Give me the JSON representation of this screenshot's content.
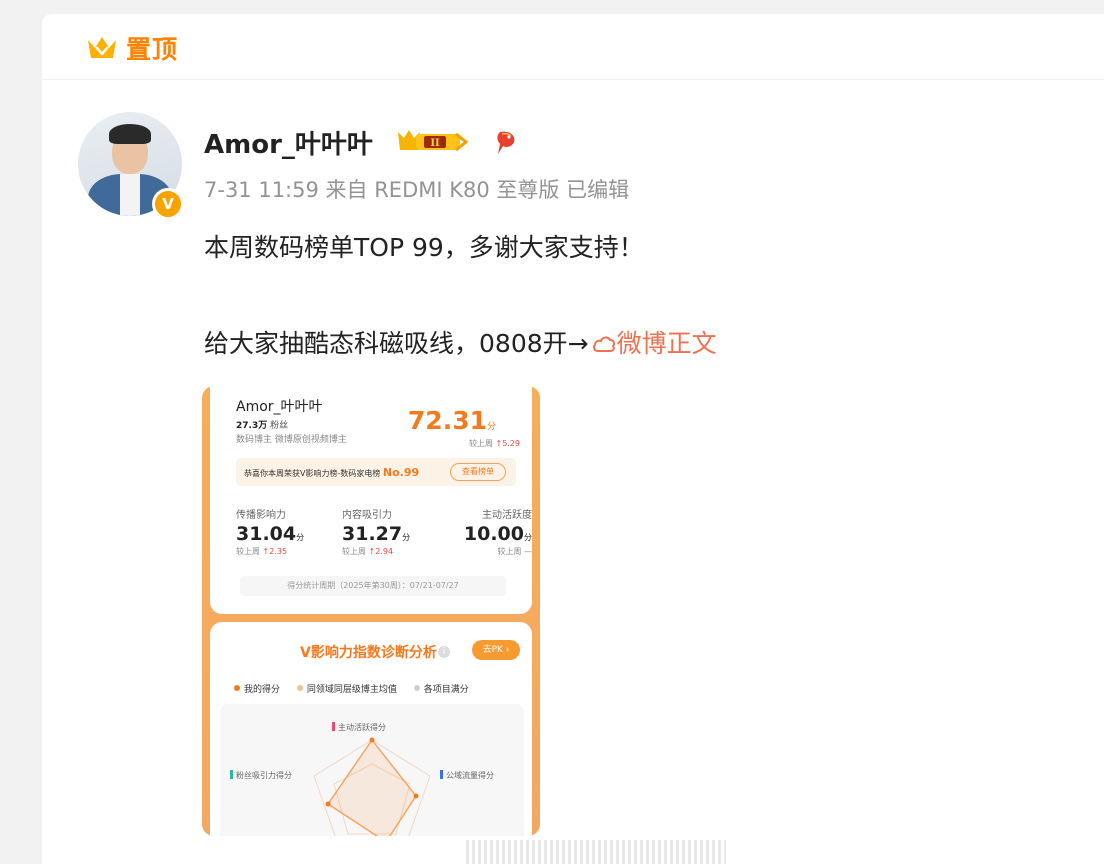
{
  "pinned": {
    "label": "置顶"
  },
  "author": {
    "name": "Amor_叶叶叶",
    "verified_badge": "V"
  },
  "meta": {
    "text": "7-31 11:59  来自 REDMI K80 至尊版 已编辑"
  },
  "post": {
    "line1": "本周数码榜单TOP 99，多谢大家支持！",
    "line2": "给大家抽酷态科磁吸线，0808开→",
    "link_text": "微博正文"
  },
  "screenshot": {
    "name": "Amor_叶叶叶",
    "fans_count": "27.3万",
    "fans_label": "粉丝",
    "role": "数码博主 微博原创视频博主",
    "score": "72.31",
    "score_unit": "分",
    "score_cmp_label": "较上周",
    "score_cmp_value": "5.29",
    "notice": "恭喜你本周荣获V影响力榜-数码家电榜",
    "rank": "No.99",
    "notice_button": "查看榜单",
    "metrics": [
      {
        "label": "传播影响力",
        "value": "31.04",
        "unit": "分",
        "cmp_label": "较上周",
        "cmp": "2.35"
      },
      {
        "label": "内容吸引力",
        "value": "31.27",
        "unit": "分",
        "cmp_label": "较上周",
        "cmp": "2.94"
      },
      {
        "label": "主动活跃度",
        "value": "10.00",
        "unit": "分",
        "cmp_label": "较上周",
        "cmp": "—"
      }
    ],
    "period": "得分统计周期（2025年第30周）：07/21-07/27",
    "analysis_title": "V影响力指数诊断分析",
    "pk_button": "去PK",
    "legend": [
      "我的得分",
      "同领域同层级博主均值",
      "各项目满分"
    ],
    "radar_labels": [
      "主动活跃得分",
      "粉丝吸引力得分",
      "公域流量得分"
    ]
  },
  "colors": {
    "accent": "#ff8200",
    "link": "#eb7350",
    "orange": "#f47a1e",
    "red": "#e8493e"
  }
}
